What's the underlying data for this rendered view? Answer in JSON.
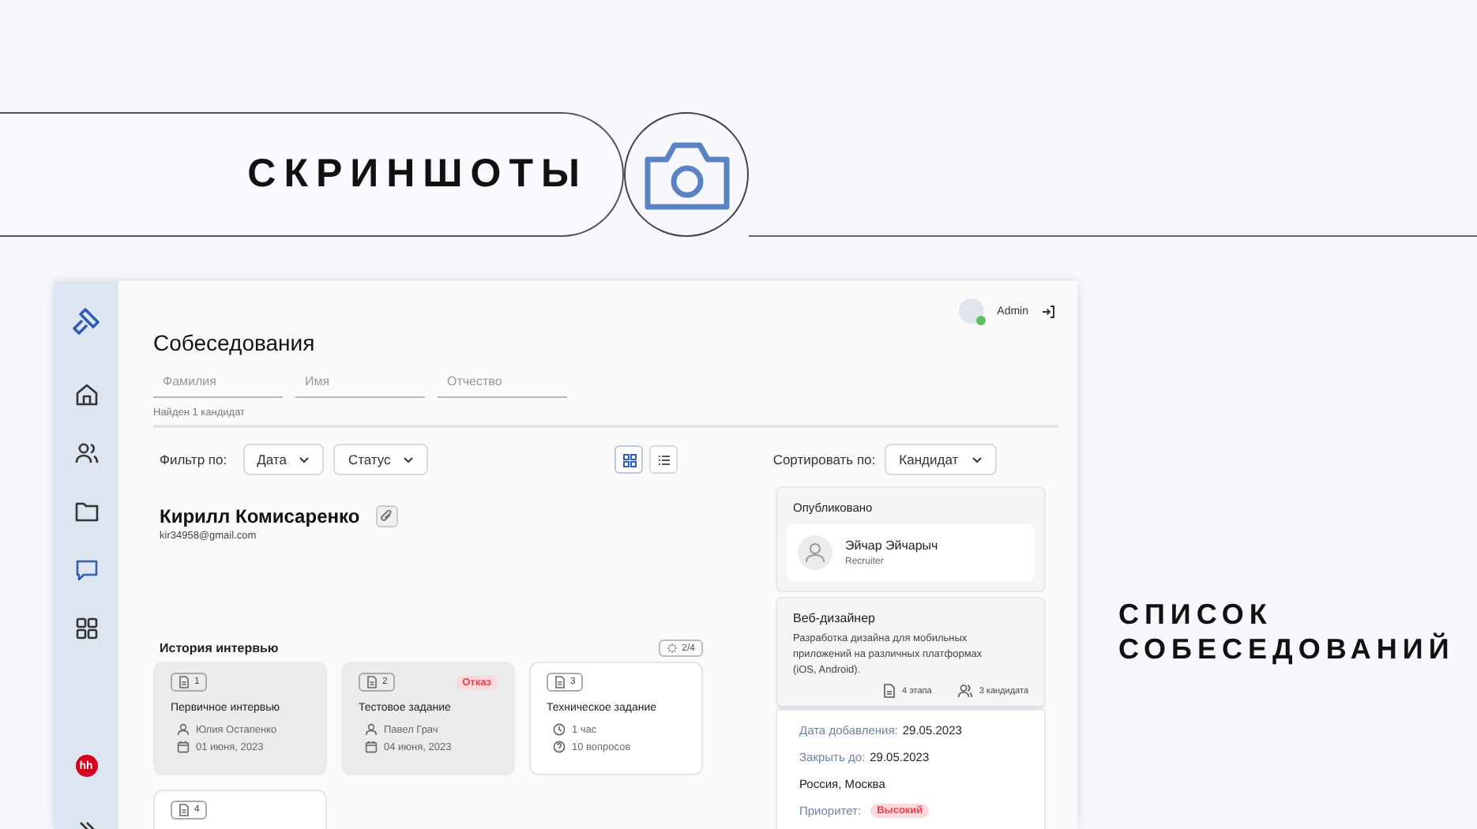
{
  "slide": {
    "heading": "СКРИНШОТЫ",
    "caption": "СПИСОК СОБЕСЕДОВАНИЙ"
  },
  "sidebar": {
    "items": [
      {
        "selected": false
      },
      {
        "selected": false
      },
      {
        "selected": false
      },
      {
        "selected": true
      },
      {
        "selected": false
      }
    ],
    "brand": "hh"
  },
  "user": {
    "name": "Admin",
    "online": true
  },
  "page": {
    "title": "Собеседования"
  },
  "search_fields": [
    {
      "placeholder": "Фамилия"
    },
    {
      "placeholder": "Имя"
    },
    {
      "placeholder": "Отчество"
    }
  ],
  "result_count": "Найден 1 кандидат",
  "filter": {
    "label": "Фильтр по:",
    "dropdowns": [
      "Дата",
      "Статус"
    ]
  },
  "view_toggle": [
    {
      "kind": "grid",
      "selected": true
    },
    {
      "kind": "list",
      "selected": false
    }
  ],
  "sort": {
    "label": "Сортировать по:",
    "value": "Кандидат"
  },
  "candidate": {
    "name": "Кирилл Комисаренко",
    "email": "kir34958@gmail.com"
  },
  "history": {
    "title": "История интервью",
    "progress": "2/4",
    "cards": [
      {
        "number": "1",
        "title": "Первичное интервью",
        "completed": true,
        "meta": [
          {
            "kind": "person",
            "text": "Юлия Остапенко"
          },
          {
            "kind": "date",
            "text": "01 июня, 2023"
          }
        ]
      },
      {
        "number": "2",
        "title": "Тестовое задание",
        "completed": true,
        "status": "Отказ",
        "meta": [
          {
            "kind": "person",
            "text": "Павел Грач"
          },
          {
            "kind": "date",
            "text": "04 июня, 2023"
          }
        ]
      },
      {
        "number": "3",
        "title": "Техническое задание",
        "completed": false,
        "meta": [
          {
            "kind": "time",
            "text": "1 час"
          },
          {
            "kind": "questions",
            "text": "10 вопросов"
          }
        ]
      },
      {
        "number": "4",
        "completed": false
      }
    ]
  },
  "published": {
    "title": "Опубликовано",
    "name": "Эйчар Эйчарыч",
    "role": "Recruiter"
  },
  "vacancy": {
    "title": "Веб-дизайнер",
    "description": "Разработка дизайна для мобильных приложений на различных платформах (iOS, Android).",
    "stages": "4 этапа",
    "candidates": "3 кандидата"
  },
  "details": {
    "dates": [
      {
        "label": "Дата добавления:",
        "value": "29.05.2023"
      },
      {
        "label": "Закрыть до:",
        "value": "29.05.2023"
      }
    ],
    "location": "Россия, Москва",
    "priority": {
      "label": "Приоритет:",
      "value": "Высокий"
    }
  }
}
